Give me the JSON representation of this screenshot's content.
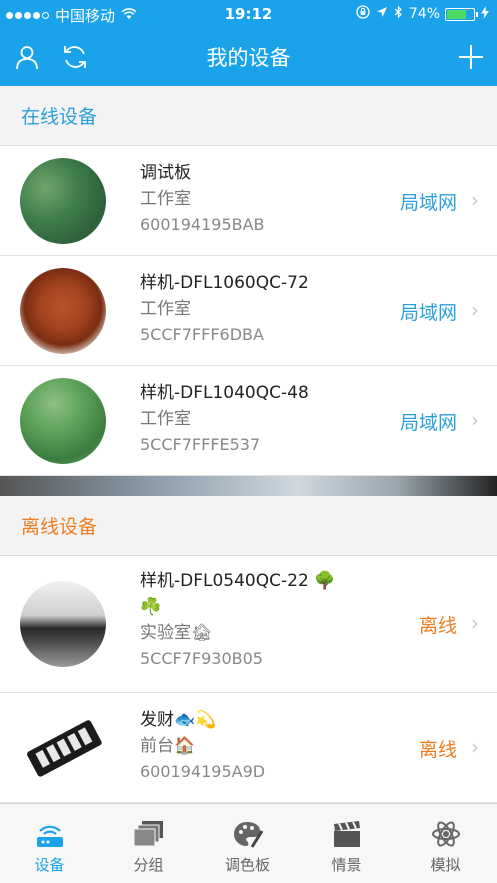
{
  "status_bar": {
    "carrier": "中国移动",
    "time": "19:12",
    "battery": "74%",
    "battery_level": 0.74
  },
  "navbar": {
    "title": "我的设备",
    "left_icons": [
      "user-icon",
      "refresh-icon"
    ],
    "right_icon": "plus-icon"
  },
  "sections": {
    "online_title": "在线设备",
    "offline_title": "离线设备"
  },
  "online_devices": [
    {
      "name": "调试板",
      "room": "工作室",
      "mac": "600194195BAB",
      "status": "局域网",
      "avatar": "lotus-leaves"
    },
    {
      "name": "样机-DFL1060QC-72",
      "room": "工作室",
      "mac": "5CCF7FFF6DBA",
      "status": "局域网",
      "avatar": "puppy"
    },
    {
      "name": "样机-DFL1040QC-48",
      "room": "工作室",
      "mac": "5CCF7FFFE537",
      "status": "局域网",
      "avatar": "lotus-leaves"
    }
  ],
  "offline_devices": [
    {
      "name": "样机-DFL0540QC-22 🌳",
      "name2": "☘️",
      "room": "实验室🏚",
      "mac": "5CCF7F930B05",
      "status": "离线",
      "avatar": "landscape"
    },
    {
      "name": "发财🐟💫",
      "room": "前台🏠",
      "mac": "600194195A9D",
      "status": "离线",
      "avatar": "device"
    }
  ],
  "tabs": [
    {
      "label": "设备",
      "icon": "router-icon",
      "active": true
    },
    {
      "label": "分组",
      "icon": "group-icon",
      "active": false
    },
    {
      "label": "调色板",
      "icon": "palette-icon",
      "active": false
    },
    {
      "label": "情景",
      "icon": "scene-icon",
      "active": false
    },
    {
      "label": "模拟",
      "icon": "atom-icon",
      "active": false
    }
  ],
  "colors": {
    "primary": "#1aa3ea",
    "online": "#2aa0dd",
    "offline": "#ef7d22"
  }
}
